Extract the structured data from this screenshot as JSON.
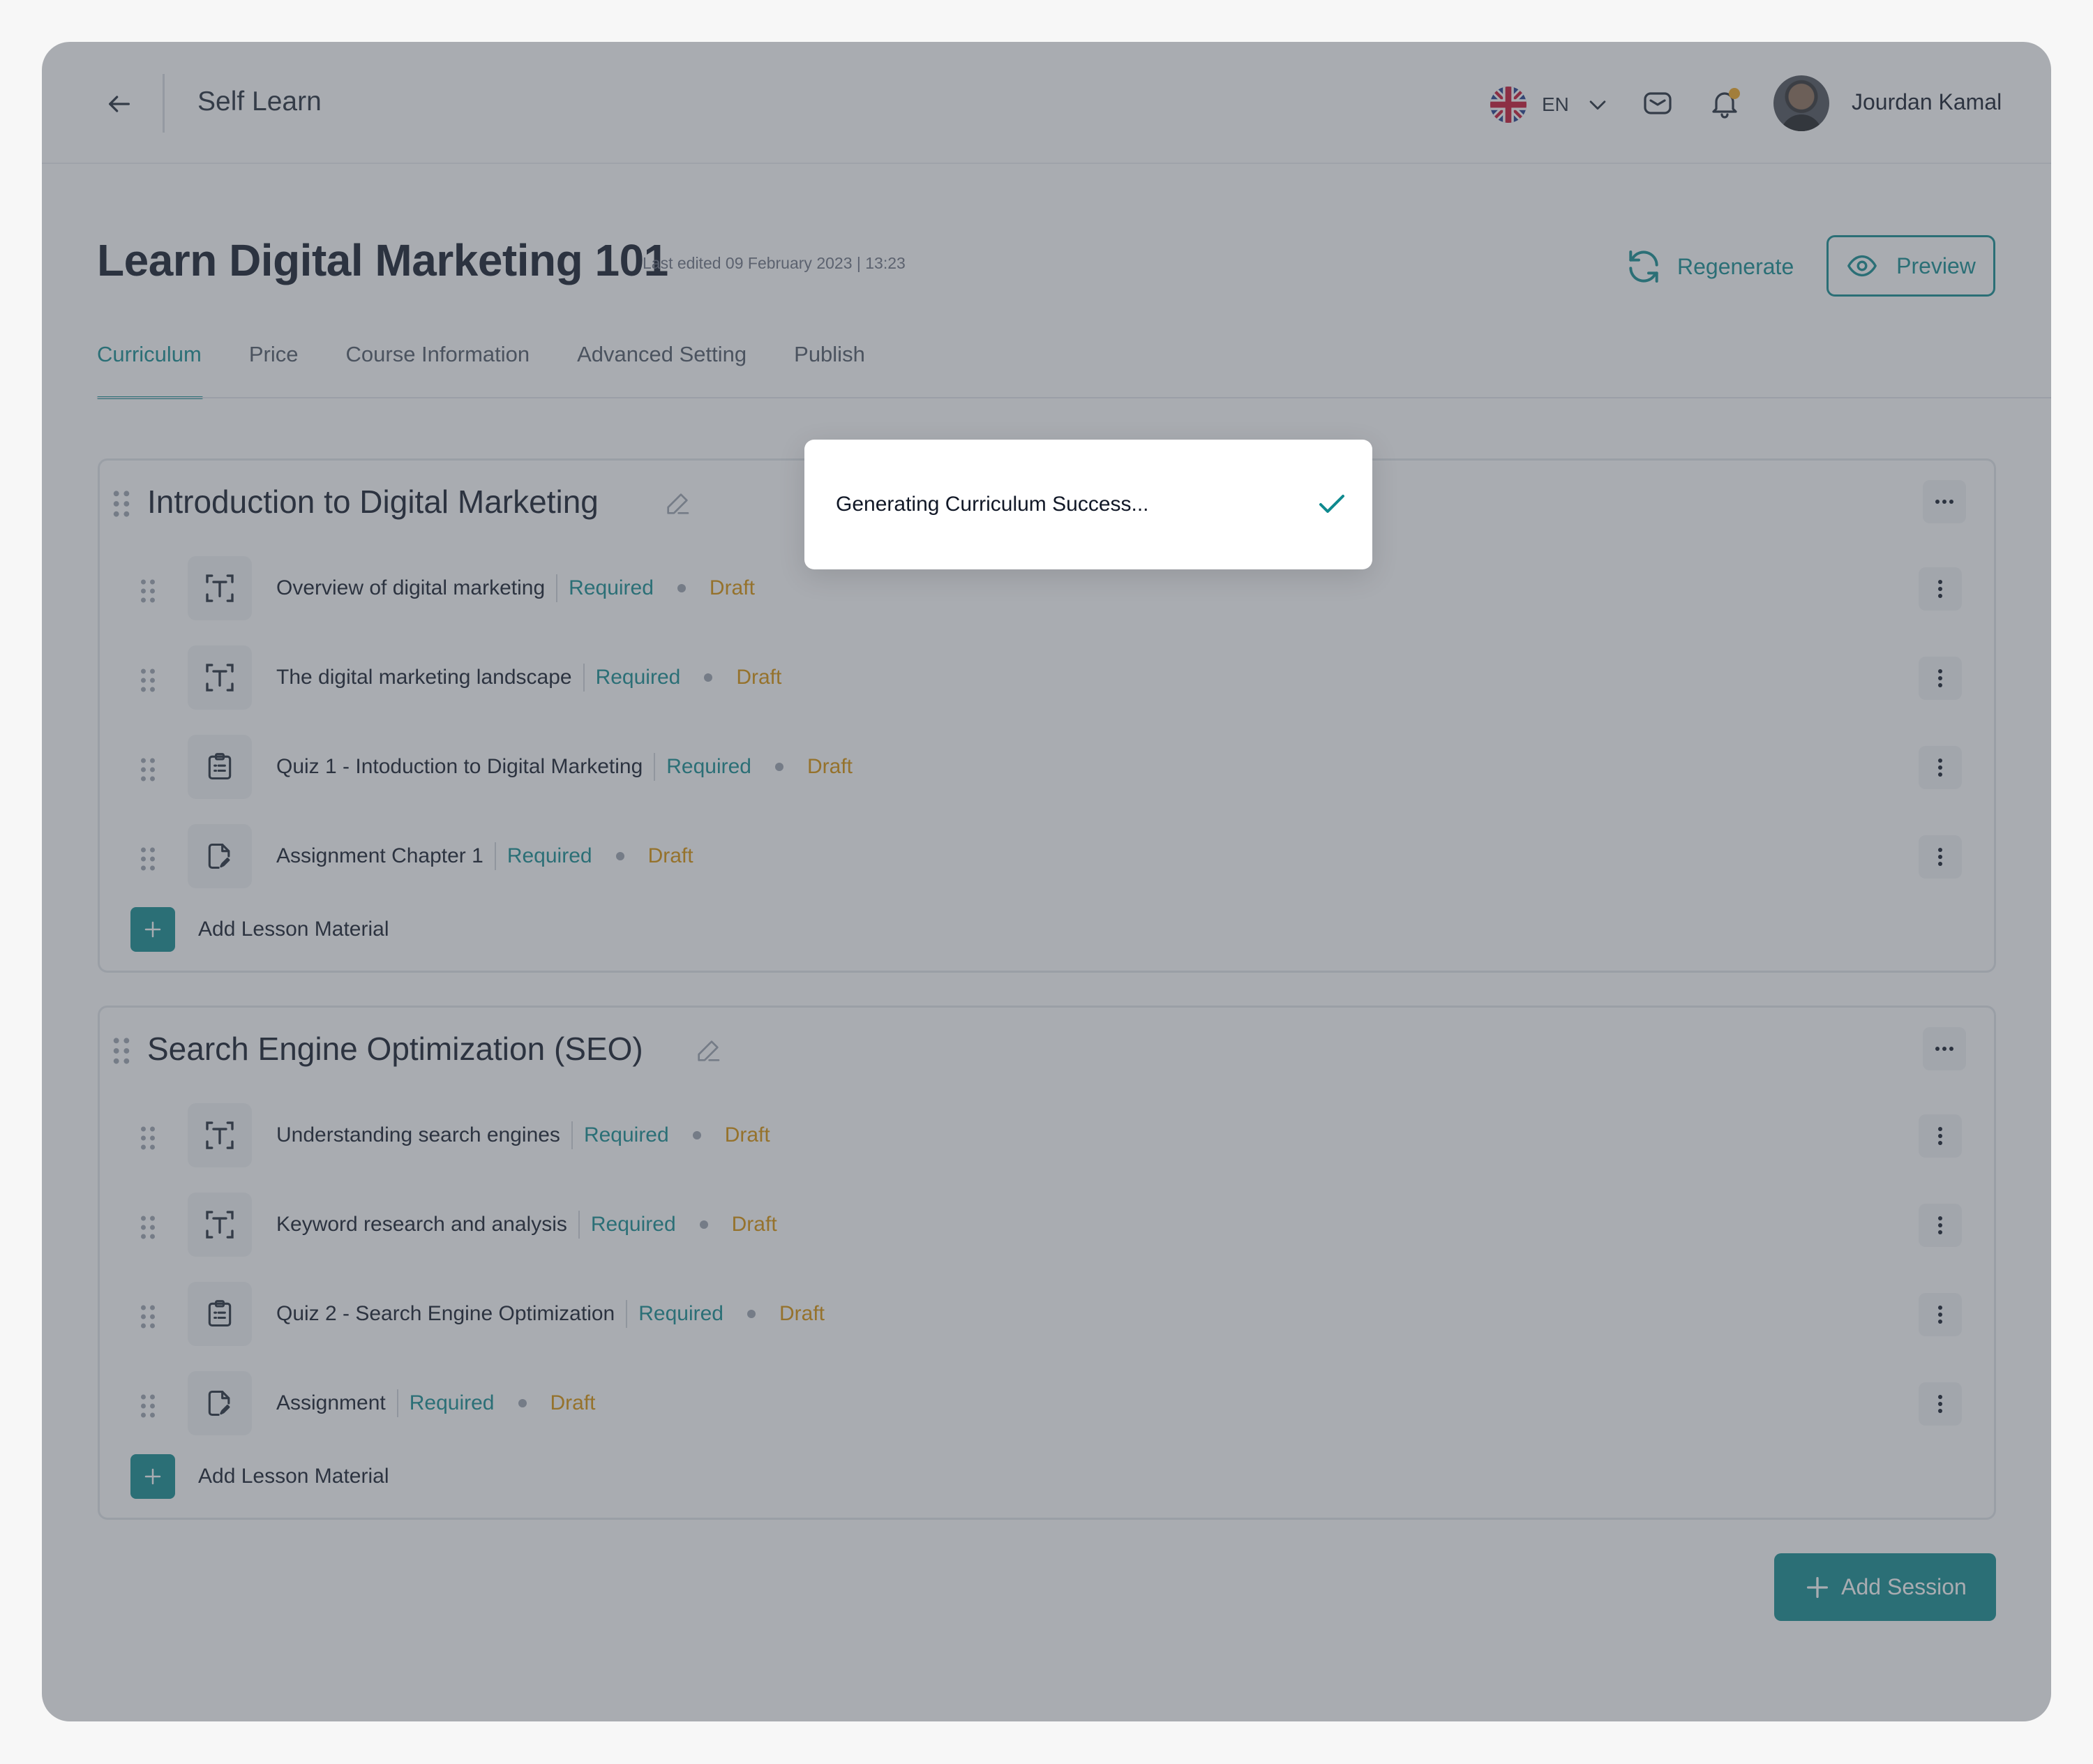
{
  "header": {
    "app_title": "Self Learn",
    "language": "EN",
    "user_name": "Jourdan Kamal"
  },
  "course": {
    "title": "Learn Digital Marketing 101",
    "last_edited": "Last edited 09 February 2023 | 13:23",
    "regenerate_label": "Regenerate",
    "preview_label": "Preview"
  },
  "tabs": [
    {
      "label": "Curriculum",
      "active": true
    },
    {
      "label": "Price"
    },
    {
      "label": "Course Information"
    },
    {
      "label": "Advanced Setting"
    },
    {
      "label": "Publish"
    }
  ],
  "sessions": [
    {
      "title": "Introduction to Digital Marketing",
      "lessons": [
        {
          "icon": "text-icon",
          "title": "Overview of digital marketing",
          "required": "Required",
          "status": "Draft"
        },
        {
          "icon": "text-icon",
          "title": "The digital marketing landscape",
          "required": "Required",
          "status": "Draft"
        },
        {
          "icon": "quiz-icon",
          "title": "Quiz 1 - Intoduction to Digital Marketing",
          "required": "Required",
          "status": "Draft"
        },
        {
          "icon": "assignment-icon",
          "title": "Assignment Chapter 1",
          "required": "Required",
          "status": "Draft"
        }
      ],
      "add_lesson_label": "Add Lesson Material"
    },
    {
      "title": "Search Engine Optimization (SEO)",
      "lessons": [
        {
          "icon": "text-icon",
          "title": "Understanding search engines",
          "required": "Required",
          "status": "Draft"
        },
        {
          "icon": "text-icon",
          "title": "Keyword research and analysis",
          "required": "Required",
          "status": "Draft"
        },
        {
          "icon": "quiz-icon",
          "title": "Quiz 2 - Search Engine Optimization",
          "required": "Required",
          "status": "Draft"
        },
        {
          "icon": "assignment-icon",
          "title": "Assignment",
          "required": "Required",
          "status": "Draft"
        }
      ],
      "add_lesson_label": "Add Lesson Material"
    }
  ],
  "add_session_label": "Add Session",
  "toast": {
    "message": "Generating Curriculum Success..."
  },
  "colors": {
    "accent": "#0f8a8f",
    "draft": "#d99000",
    "overlay": "#4c515c"
  }
}
